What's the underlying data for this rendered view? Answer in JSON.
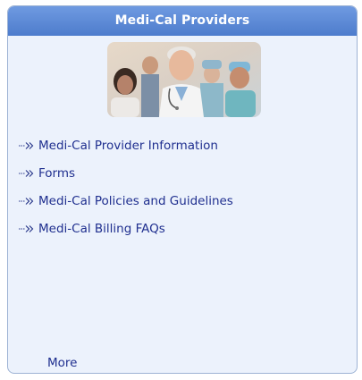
{
  "panel": {
    "title": "Medi-Cal Providers",
    "photo": "medical-staff-photo",
    "links": [
      {
        "label": "Medi-Cal Provider Information",
        "icon": "double-chevron-right-icon"
      },
      {
        "label": "Forms",
        "icon": "double-chevron-right-icon"
      },
      {
        "label": "Medi-Cal Policies and Guidelines",
        "icon": "double-chevron-right-icon"
      },
      {
        "label": "Medi-Cal Billing FAQs",
        "icon": "double-chevron-right-icon"
      }
    ],
    "more_label": "More"
  },
  "colors": {
    "header": "#5a86d4",
    "panel_bg": "#ecf2fc",
    "border": "#9db3d4",
    "link": "#1f2f8f"
  }
}
